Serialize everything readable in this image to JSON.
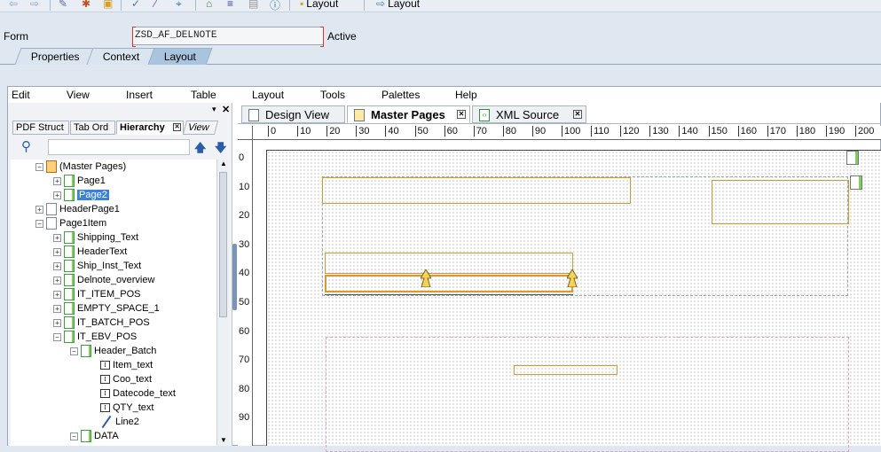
{
  "toolbar": {
    "layout_btn1": "Layout",
    "layout_btn2": "Layout"
  },
  "form": {
    "label": "Form",
    "value": "ZSD_AF_DELNOTE",
    "status": "Active"
  },
  "main_tabs": [
    "Properties",
    "Context",
    "Layout"
  ],
  "menu": [
    "Edit",
    "View",
    "Insert",
    "Table",
    "Layout",
    "Tools",
    "Palettes",
    "Help"
  ],
  "left_tabs": [
    "PDF Struct",
    "Tab Ord",
    "Hierarchy",
    "View"
  ],
  "tree": [
    {
      "label": "(Master Pages)",
      "level": 0
    },
    {
      "label": "Page1",
      "level": 1
    },
    {
      "label": "Page2",
      "level": 1,
      "selected": true
    },
    {
      "label": "HeaderPage1",
      "level": 0
    },
    {
      "label": "Page1Item",
      "level": 0
    },
    {
      "label": "Shipping_Text",
      "level": 1
    },
    {
      "label": "HeaderText",
      "level": 1
    },
    {
      "label": "Ship_Inst_Text",
      "level": 1
    },
    {
      "label": "Delnote_overview",
      "level": 1
    },
    {
      "label": "IT_ITEM_POS",
      "level": 1
    },
    {
      "label": "EMPTY_SPACE_1",
      "level": 1
    },
    {
      "label": "IT_BATCH_POS",
      "level": 1
    },
    {
      "label": "IT_EBV_POS",
      "level": 1
    },
    {
      "label": "Header_Batch",
      "level": 2
    },
    {
      "label": "Item_text",
      "level": 3
    },
    {
      "label": "Coo_text",
      "level": 3
    },
    {
      "label": "Datecode_text",
      "level": 3
    },
    {
      "label": "QTY_text",
      "level": 3
    },
    {
      "label": "Line2",
      "level": 3
    },
    {
      "label": "DATA",
      "level": 2
    }
  ],
  "design_tabs": [
    "Design View",
    "Master Pages",
    "XML Source"
  ],
  "ruler_h": [
    "0",
    "10",
    "20",
    "30",
    "40",
    "50",
    "60",
    "70",
    "80",
    "90",
    "100",
    "110",
    "120",
    "130",
    "140",
    "150",
    "160",
    "170",
    "180",
    "190",
    "200"
  ],
  "ruler_v": [
    "0",
    "10",
    "20",
    "30",
    "40",
    "50",
    "60",
    "70",
    "80",
    "90"
  ],
  "colors": {
    "accent": "#3b82d6",
    "frame": "#d89a2a",
    "tab_active": "#a9c4de"
  }
}
